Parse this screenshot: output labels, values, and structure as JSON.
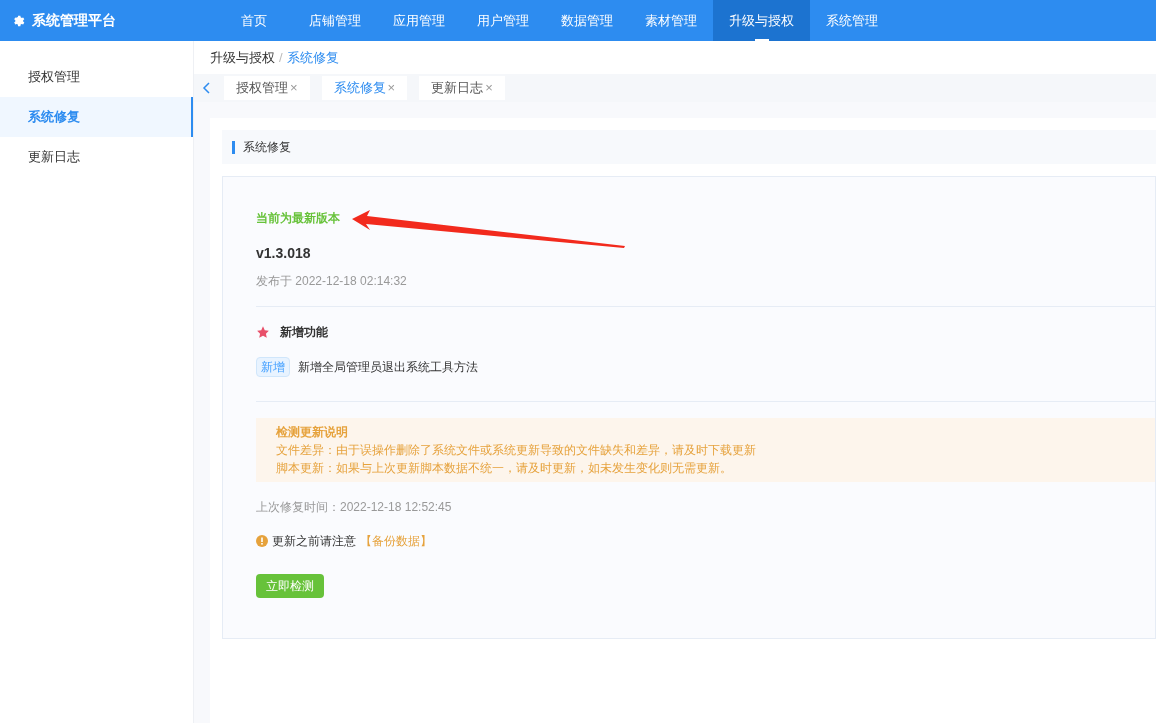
{
  "app": {
    "title": "系统管理平台"
  },
  "nav": [
    {
      "label": "首页",
      "selected": false
    },
    {
      "label": "店铺管理",
      "selected": false
    },
    {
      "label": "应用管理",
      "selected": false
    },
    {
      "label": "用户管理",
      "selected": false
    },
    {
      "label": "数据管理",
      "selected": false
    },
    {
      "label": "素材管理",
      "selected": false
    },
    {
      "label": "升级与授权",
      "selected": true
    },
    {
      "label": "系统管理",
      "selected": false
    }
  ],
  "sidebar": {
    "items": [
      {
        "label": "授权管理",
        "selected": false
      },
      {
        "label": "系统修复",
        "selected": true
      },
      {
        "label": "更新日志",
        "selected": false
      }
    ]
  },
  "breadcrumb": {
    "separator": "/",
    "items": [
      "升级与授权",
      "系统修复"
    ]
  },
  "tabs": [
    {
      "label": "授权管理",
      "close": "×",
      "selected": false
    },
    {
      "label": "系统修复",
      "close": "×",
      "selected": true
    },
    {
      "label": "更新日志",
      "close": "×",
      "selected": false
    }
  ],
  "section_title": "系统修复",
  "status": "当前为最新版本",
  "version": "v1.3.018",
  "published": "发布于 2022-12-18 02:14:32",
  "features": {
    "title": "新增功能",
    "items": [
      {
        "tag": "新增",
        "text": "新增全局管理员退出系统工具方法"
      }
    ]
  },
  "notice": {
    "title": "检测更新说明",
    "lines": [
      "文件差异：由于误操作删除了系统文件或系统更新导致的文件缺失和差异，请及时下载更新",
      "脚本更新：如果与上次更新脚本数据不统一，请及时更新，如未发生变化则无需更新。"
    ]
  },
  "last_repair": "上次修复时间：2022-12-18 12:52:45",
  "warning": {
    "text": "更新之前请注意",
    "link": "【备份数据】"
  },
  "check_button": "立即检测"
}
